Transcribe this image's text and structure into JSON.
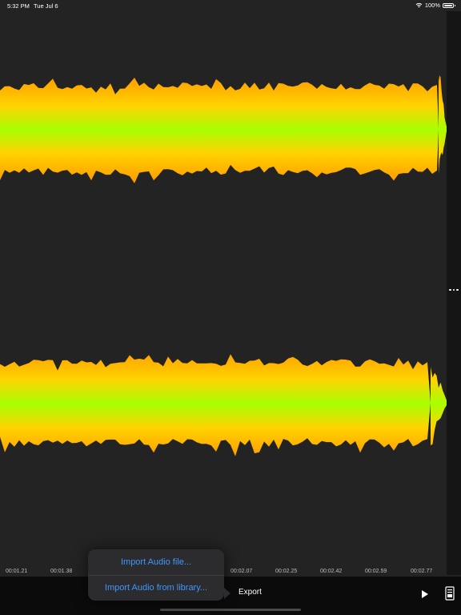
{
  "status_bar": {
    "time": "5:32 PM",
    "date": "Tue Jul 6",
    "battery": "100%"
  },
  "timeline": {
    "ticks": [
      "00:01.21",
      "00:01.38",
      "00:02.07",
      "00:02.25",
      "00:02.42",
      "00:02.59",
      "00:02.77"
    ]
  },
  "toolbar": {
    "export_label": "Export"
  },
  "popup": {
    "import_file_label": "Import Audio file...",
    "import_library_label": "Import Audio from library..."
  },
  "colors": {
    "wave_outer": "#ff9a00",
    "wave_mid": "#ffe600",
    "wave_center": "#a8ff00",
    "accent": "#3d97ff",
    "background": "#232323"
  },
  "icons": {
    "wifi": "wifi-icon",
    "battery": "battery-icon",
    "more": "more-icon",
    "play": "play-icon",
    "document": "document-icon"
  }
}
